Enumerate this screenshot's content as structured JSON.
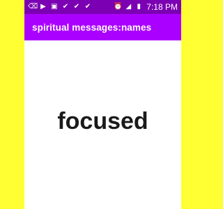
{
  "status_bar": {
    "icons": [
      "keyboard-backspace-icon",
      "youtube-icon",
      "gallery-icon",
      "checkmark-icon",
      "checkmark-icon",
      "checkmark-icon",
      "alarm-icon",
      "signal-icon",
      "battery-icon"
    ],
    "time": "7:18 PM"
  },
  "app_bar": {
    "title": "spiritual messages:names"
  },
  "main": {
    "word": "focused"
  },
  "colors": {
    "background_side": "#ffff33",
    "status_bar": "#7c00b3",
    "app_bar": "#aa00ff",
    "content_bg": "#ffffff",
    "text_dark": "#1a1a1a"
  }
}
